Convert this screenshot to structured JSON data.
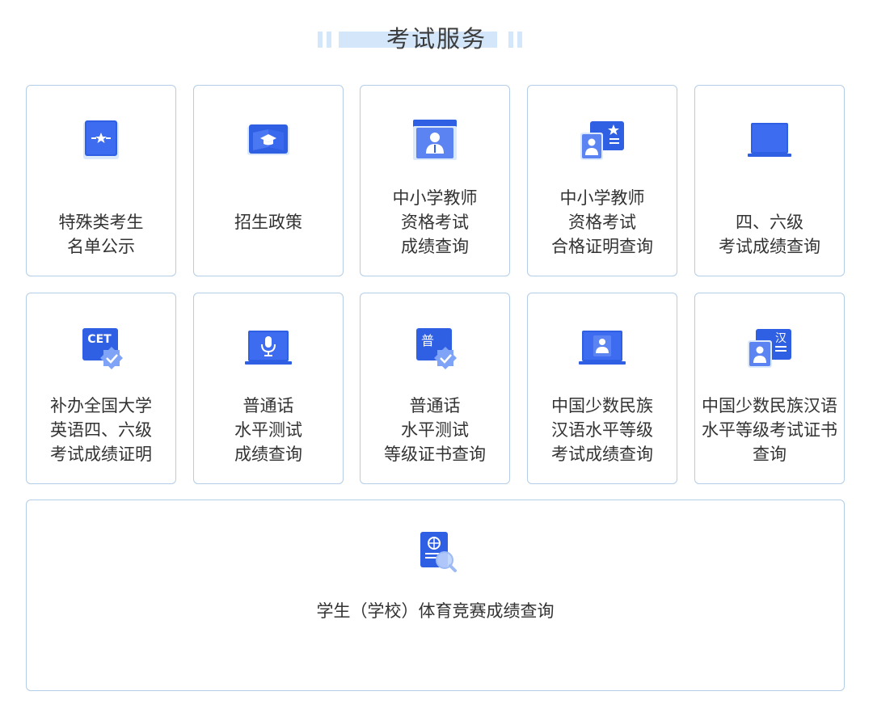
{
  "header": {
    "title": "考试服务"
  },
  "services": [
    {
      "icon": "special-candidate-star-icon",
      "lines": [
        "特殊类考生",
        "名单公示"
      ]
    },
    {
      "icon": "enrollment-policy-book-icon",
      "lines": [
        "招生政策"
      ]
    },
    {
      "icon": "teacher-certificate-person-icon",
      "lines": [
        "中小学教师",
        "资格考试",
        "成绩查询"
      ]
    },
    {
      "icon": "teacher-qualification-card-icon",
      "lines": [
        "中小学教师",
        "资格考试",
        "合格证明查询"
      ]
    },
    {
      "icon": "cet-laptop-icon",
      "lines": [
        "四、六级",
        "考试成绩查询"
      ]
    },
    {
      "icon": "cet-badge-icon",
      "lines": [
        "补办全国大学",
        "英语四、六级",
        "考试成绩证明"
      ]
    },
    {
      "icon": "microphone-laptop-icon",
      "lines": [
        "普通话",
        "水平测试",
        "成绩查询"
      ]
    },
    {
      "icon": "mandarin-certificate-badge-icon",
      "lines": [
        "普通话",
        "水平测试",
        "等级证书查询"
      ]
    },
    {
      "icon": "minority-chinese-laptop-icon",
      "lines": [
        "中国少数民族",
        "汉语水平等级",
        "考试成绩查询"
      ]
    },
    {
      "icon": "minority-chinese-certificate-icon",
      "lines": [
        "中国少数民族汉语",
        "水平等级考试证书",
        "查询"
      ]
    },
    {
      "icon": "sports-score-search-icon",
      "lines": [
        "学生（学校）体育竞赛成绩查询"
      ]
    }
  ],
  "icon_text": {
    "cet": "CET",
    "pu": "普",
    "han": "汉"
  },
  "colors": {
    "card_border": "#b4cde8",
    "icon_blue": "#2f5fe3",
    "icon_light": "#dce9fb",
    "header_bar": "#d3e6fa",
    "text": "#333333"
  }
}
